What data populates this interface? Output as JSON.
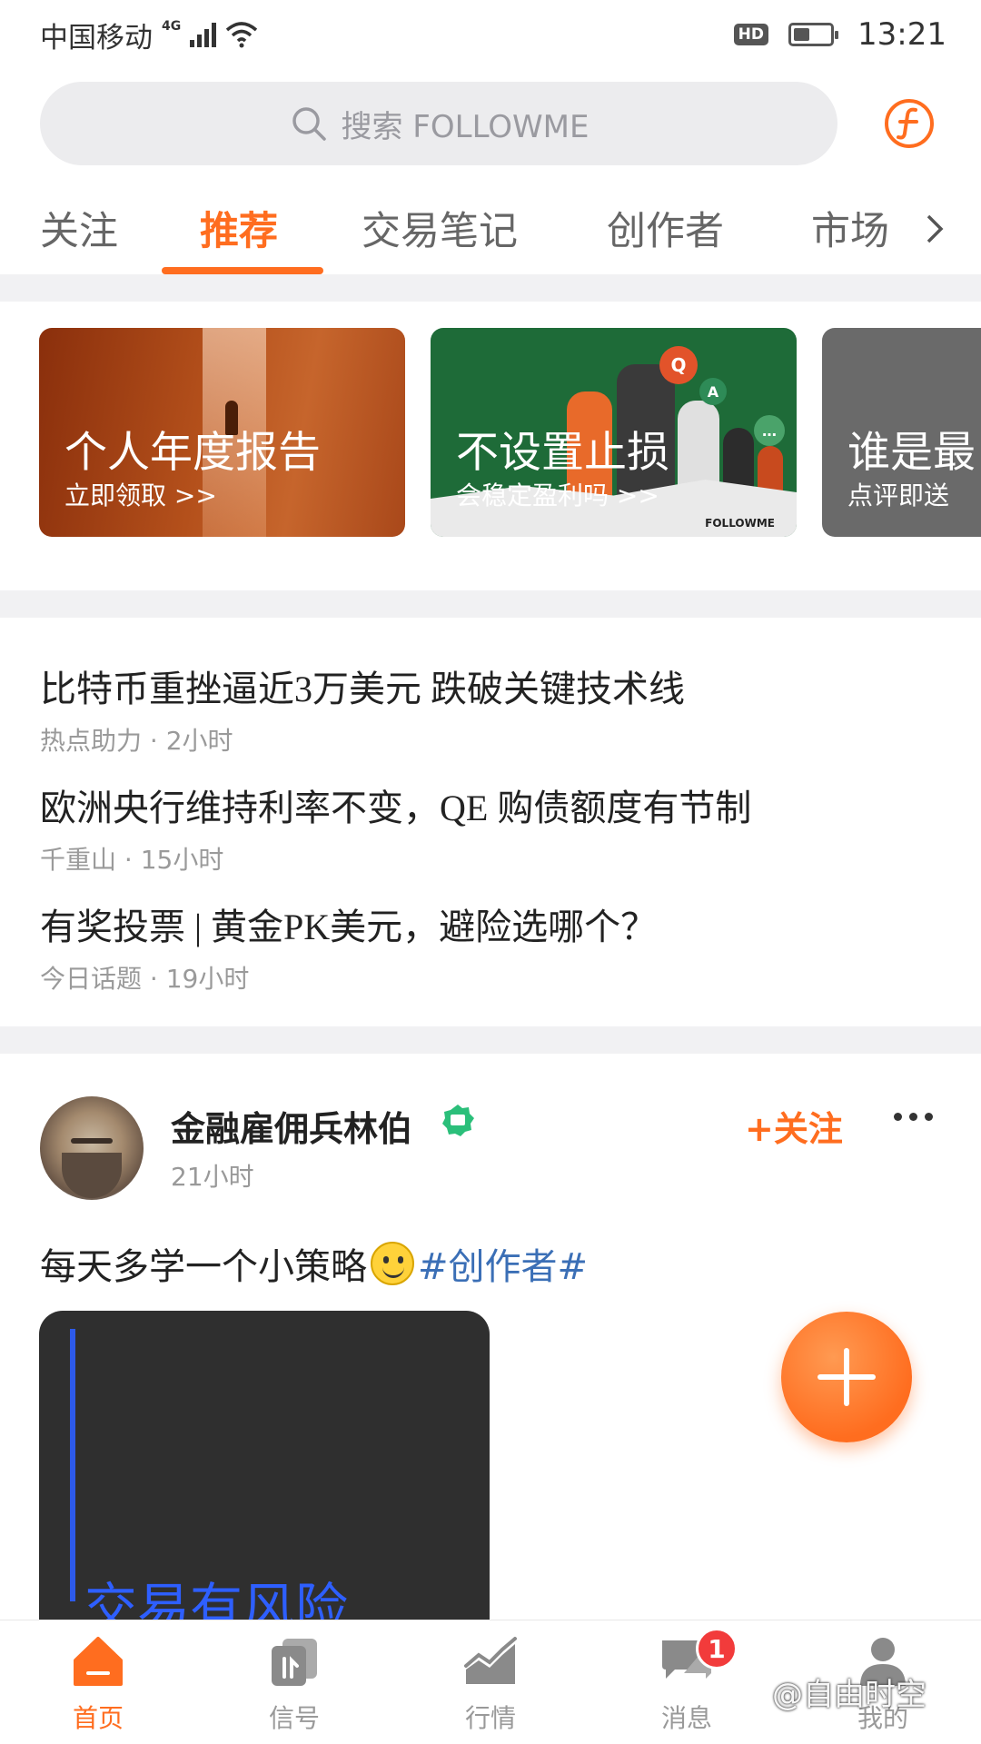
{
  "status_bar": {
    "carrier": "中国移动",
    "network": "4G",
    "hd": "HD",
    "battery_level": 0.45,
    "time": "13:21"
  },
  "search": {
    "placeholder": "搜索 FOLLOWME"
  },
  "tabs": [
    {
      "label": "关注",
      "active": false
    },
    {
      "label": "推荐",
      "active": true
    },
    {
      "label": "交易笔记",
      "active": false
    },
    {
      "label": "创作者",
      "active": false
    },
    {
      "label": "市场",
      "active": false
    }
  ],
  "banners": [
    {
      "title": "个人年度报告",
      "subtitle": "立即领取 >>"
    },
    {
      "title": "不设置止损",
      "subtitle": "会稳定盈利吗 >>",
      "brand": "FOLLOWME",
      "bubbles": [
        "Q",
        "A",
        "…"
      ]
    },
    {
      "title": "谁是最",
      "subtitle": "点评即送"
    }
  ],
  "headlines": [
    {
      "title": "比特币重挫逼近3万美元 跌破关键技术线",
      "meta": "热点助力 · 2小时"
    },
    {
      "title": "欧洲央行维持利率不变，QE 购债额度有节制",
      "meta": "千重山 · 15小时"
    },
    {
      "title": "有奖投票 | 黄金PK美元，避险选哪个？",
      "meta": "今日话题 · 19小时"
    }
  ],
  "post": {
    "author": "金融雇佣兵林伯",
    "time": "21小时",
    "follow_label": "+关注",
    "text": "每天多学一个小策略",
    "hashtag": "#创作者#",
    "image_text": "交易有风险"
  },
  "bottom_nav": [
    {
      "label": "首页",
      "icon": "home-icon",
      "active": true
    },
    {
      "label": "信号",
      "icon": "signal-icon",
      "active": false
    },
    {
      "label": "行情",
      "icon": "chart-icon",
      "active": false
    },
    {
      "label": "消息",
      "icon": "message-icon",
      "active": false,
      "badge": "1"
    },
    {
      "label": "我的",
      "icon": "profile-icon",
      "active": false
    }
  ],
  "watermark": "@自由时空",
  "colors": {
    "accent": "#ff6d1f",
    "hashtag": "#3b6fb6",
    "badge": "#f23b3b"
  }
}
